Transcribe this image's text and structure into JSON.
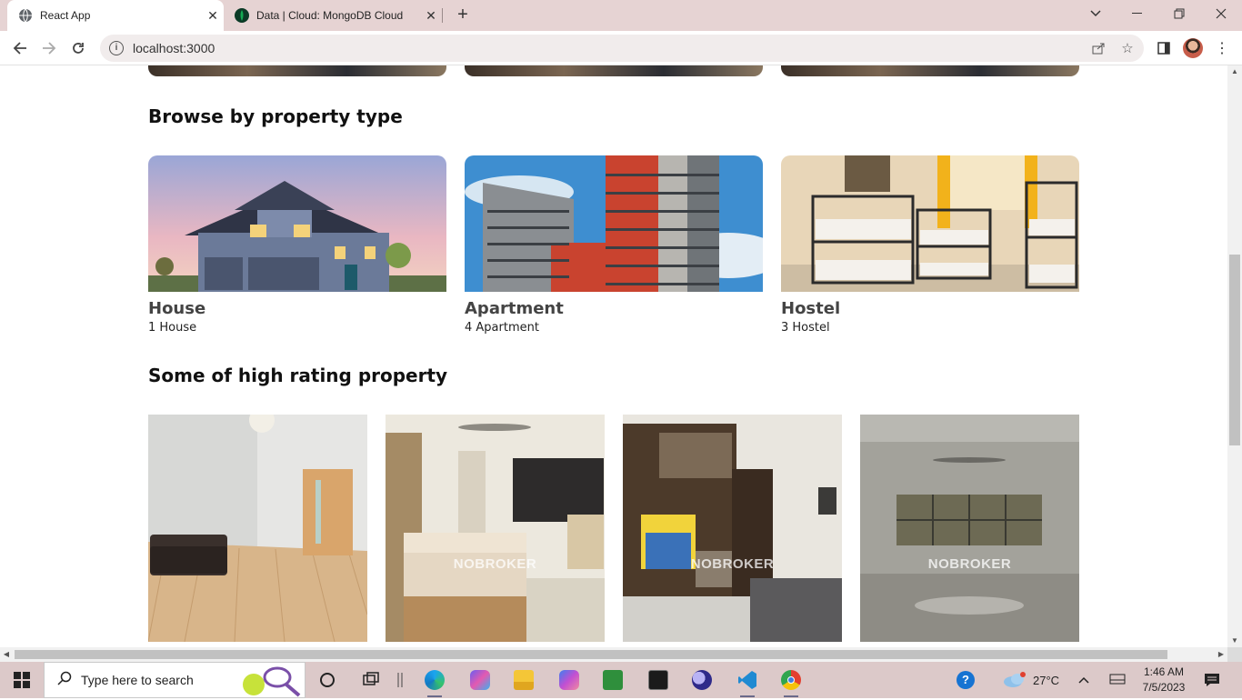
{
  "browser": {
    "tabs": [
      {
        "title": "React App",
        "icon": "globe-icon",
        "active": true
      },
      {
        "title": "Data | Cloud: MongoDB Cloud",
        "icon": "mongodb-leaf-icon",
        "active": false
      }
    ],
    "new_tab_label": "+",
    "url": "localhost:3000"
  },
  "page": {
    "property_type_heading": "Browse by property type",
    "property_types": [
      {
        "name": "House",
        "count": "1 House",
        "image": "house-photo"
      },
      {
        "name": "Apartment",
        "count": "4 Apartment",
        "image": "apartment-photo"
      },
      {
        "name": "Hostel",
        "count": "3 Hostel",
        "image": "hostel-photo"
      }
    ],
    "high_rating_heading": "Some of high rating property",
    "high_rating_properties": [
      {
        "image": "living-room-photo",
        "watermark": ""
      },
      {
        "image": "bedroom-photo",
        "watermark": "NOBROKER"
      },
      {
        "image": "room-wardrobe-photo",
        "watermark": "NOBROKER"
      },
      {
        "image": "empty-hall-photo",
        "watermark": "NOBROKER"
      }
    ]
  },
  "taskbar": {
    "search_placeholder": "Type here to search",
    "weather": "27°C",
    "time": "1:46 AM",
    "date": "7/5/2023"
  }
}
